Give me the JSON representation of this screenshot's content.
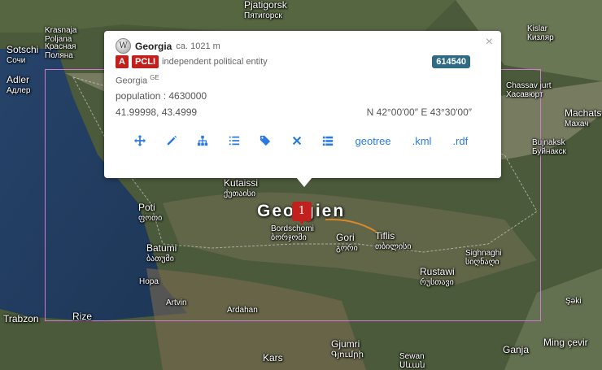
{
  "map": {
    "main_label": "Georgien",
    "places": [
      {
        "key": "pjatigorsk",
        "name": "Pjatigorsk",
        "alt": "Пятигорск"
      },
      {
        "key": "krasnaja",
        "name": "Krasnaja",
        "alt": "Poljana"
      },
      {
        "key": "krasnaja_ru",
        "name": "Красная",
        "alt": "Поляна"
      },
      {
        "key": "sotschi",
        "name": "Sotschi",
        "alt": "Сочи"
      },
      {
        "key": "adler",
        "name": "Adler",
        "alt": "Адлер"
      },
      {
        "key": "kislar",
        "name": "Kislar",
        "alt": "Кизляр"
      },
      {
        "key": "chassav",
        "name": "Chassav jurt",
        "alt": "Хасавюрт"
      },
      {
        "key": "machats",
        "name": "Machats",
        "alt": "Махач"
      },
      {
        "key": "buinaksk",
        "name": "Bujnaksk",
        "alt": "Буйнакск"
      },
      {
        "key": "kutaissi",
        "name": "Kutaissi",
        "alt": "ქუთაისი"
      },
      {
        "key": "poti",
        "name": "Poti",
        "alt": "ფოთი"
      },
      {
        "key": "bordschomi",
        "name": "Bordschomi",
        "alt": "ბორჯომი"
      },
      {
        "key": "gori",
        "name": "Gori",
        "alt": "გორი"
      },
      {
        "key": "tiflis",
        "name": "Tiflis",
        "alt": "თბილისი"
      },
      {
        "key": "batumi",
        "name": "Batumi",
        "alt": "ბათუმი"
      },
      {
        "key": "sighnaghi",
        "name": "Sighnaghi",
        "alt": "სიღნაღი"
      },
      {
        "key": "rustawi",
        "name": "Rustawi",
        "alt": "რუსთავი"
      },
      {
        "key": "hopa",
        "name": "Hopa",
        "alt": ""
      },
      {
        "key": "artvin",
        "name": "Artvin",
        "alt": ""
      },
      {
        "key": "ardahan",
        "name": "Ardahan",
        "alt": ""
      },
      {
        "key": "trabzon",
        "name": "Trabzon",
        "alt": ""
      },
      {
        "key": "rize",
        "name": "Rize",
        "alt": ""
      },
      {
        "key": "seki",
        "name": "Şəki",
        "alt": ""
      },
      {
        "key": "gjumri",
        "name": "Gjumri",
        "alt": "Գյումրի"
      },
      {
        "key": "kars",
        "name": "Kars",
        "alt": ""
      },
      {
        "key": "sewan",
        "name": "Sewan",
        "alt": "Սևան"
      },
      {
        "key": "ganja",
        "name": "Ganja",
        "alt": ""
      },
      {
        "key": "mingecevir",
        "name": "Ming çevir",
        "alt": ""
      }
    ],
    "marker_label": "1",
    "colors": {
      "bbox": "#d07ad4",
      "marker": "#c1201c"
    }
  },
  "popup": {
    "icon": "wikipedia-icon",
    "name": "Georgia",
    "elevation": "ca. 1021 m",
    "class_badge": "A",
    "code_badge": "PCLI",
    "feature_desc": "independent political entity",
    "geoname_id": "614540",
    "country": "Georgia",
    "country_code": "GE",
    "population": "population : 4630000",
    "coords": "41.99998, 43.4999",
    "dms": "N 42°00′00″ E 43°30′00″",
    "close": "×",
    "actions": [
      "move-icon",
      "edit-icon",
      "hierarchy-icon",
      "list-ol-icon",
      "tags-icon",
      "remove-icon",
      "list-icon"
    ],
    "links": {
      "geotree": "geotree",
      "kml": ".kml",
      "rdf": ".rdf"
    },
    "colors": {
      "badge_red": "#c1201c",
      "id_badge": "#2f6b85",
      "link": "#2a7ae2"
    }
  }
}
